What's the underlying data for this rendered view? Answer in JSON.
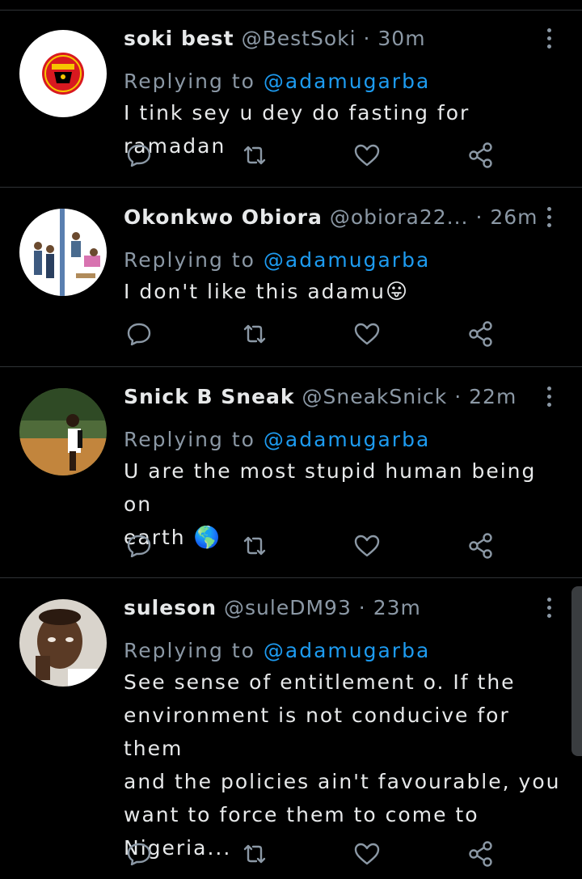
{
  "tweets": [
    {
      "name": "soki best",
      "handle": "@BestSoki",
      "dot": "·",
      "time": "30m",
      "reply_prefix": "Replying to",
      "reply_to": "@adamugarba",
      "lines": [
        "I tink sey u dey do fasting for ramadan"
      ],
      "emoji": "",
      "avatar": "manchester-united-crest"
    },
    {
      "name": "Okonkwo Obiora",
      "handle": "@obiora22...",
      "dot": "·",
      "time": "26m",
      "reply_prefix": "Replying to",
      "reply_to": "@adamugarba",
      "lines": [
        "I don't like this adamu"
      ],
      "emoji": "😛",
      "avatar": "cartoon-illustration"
    },
    {
      "name": "Snick B Sneak",
      "handle": "@SneakSnick",
      "dot": "·",
      "time": "22m",
      "reply_prefix": "Replying to",
      "reply_to": "@adamugarba",
      "lines": [
        "U are the most stupid human being on",
        "earth"
      ],
      "emoji": "🌎",
      "avatar": "person-photo"
    },
    {
      "name": "suleson",
      "handle": "@suleDM93",
      "dot": "·",
      "time": "23m",
      "reply_prefix": "Replying to",
      "reply_to": "@adamugarba",
      "lines": [
        "See sense of entitlement o. If the",
        "environment is not conducive for them",
        "and the policies ain't favourable, you",
        "want to force them to come to",
        "Nigeria..."
      ],
      "emoji": "",
      "avatar": "selfie-photo"
    }
  ],
  "icons": {
    "reply": "reply-icon",
    "retweet": "retweet-icon",
    "like": "like-icon",
    "share": "share-icon",
    "more": "more-icon"
  },
  "colors": {
    "background": "#000000",
    "text": "#e7e9ea",
    "muted": "#8b98a5",
    "mention": "#1d9bf0",
    "divider": "#2f3336"
  }
}
